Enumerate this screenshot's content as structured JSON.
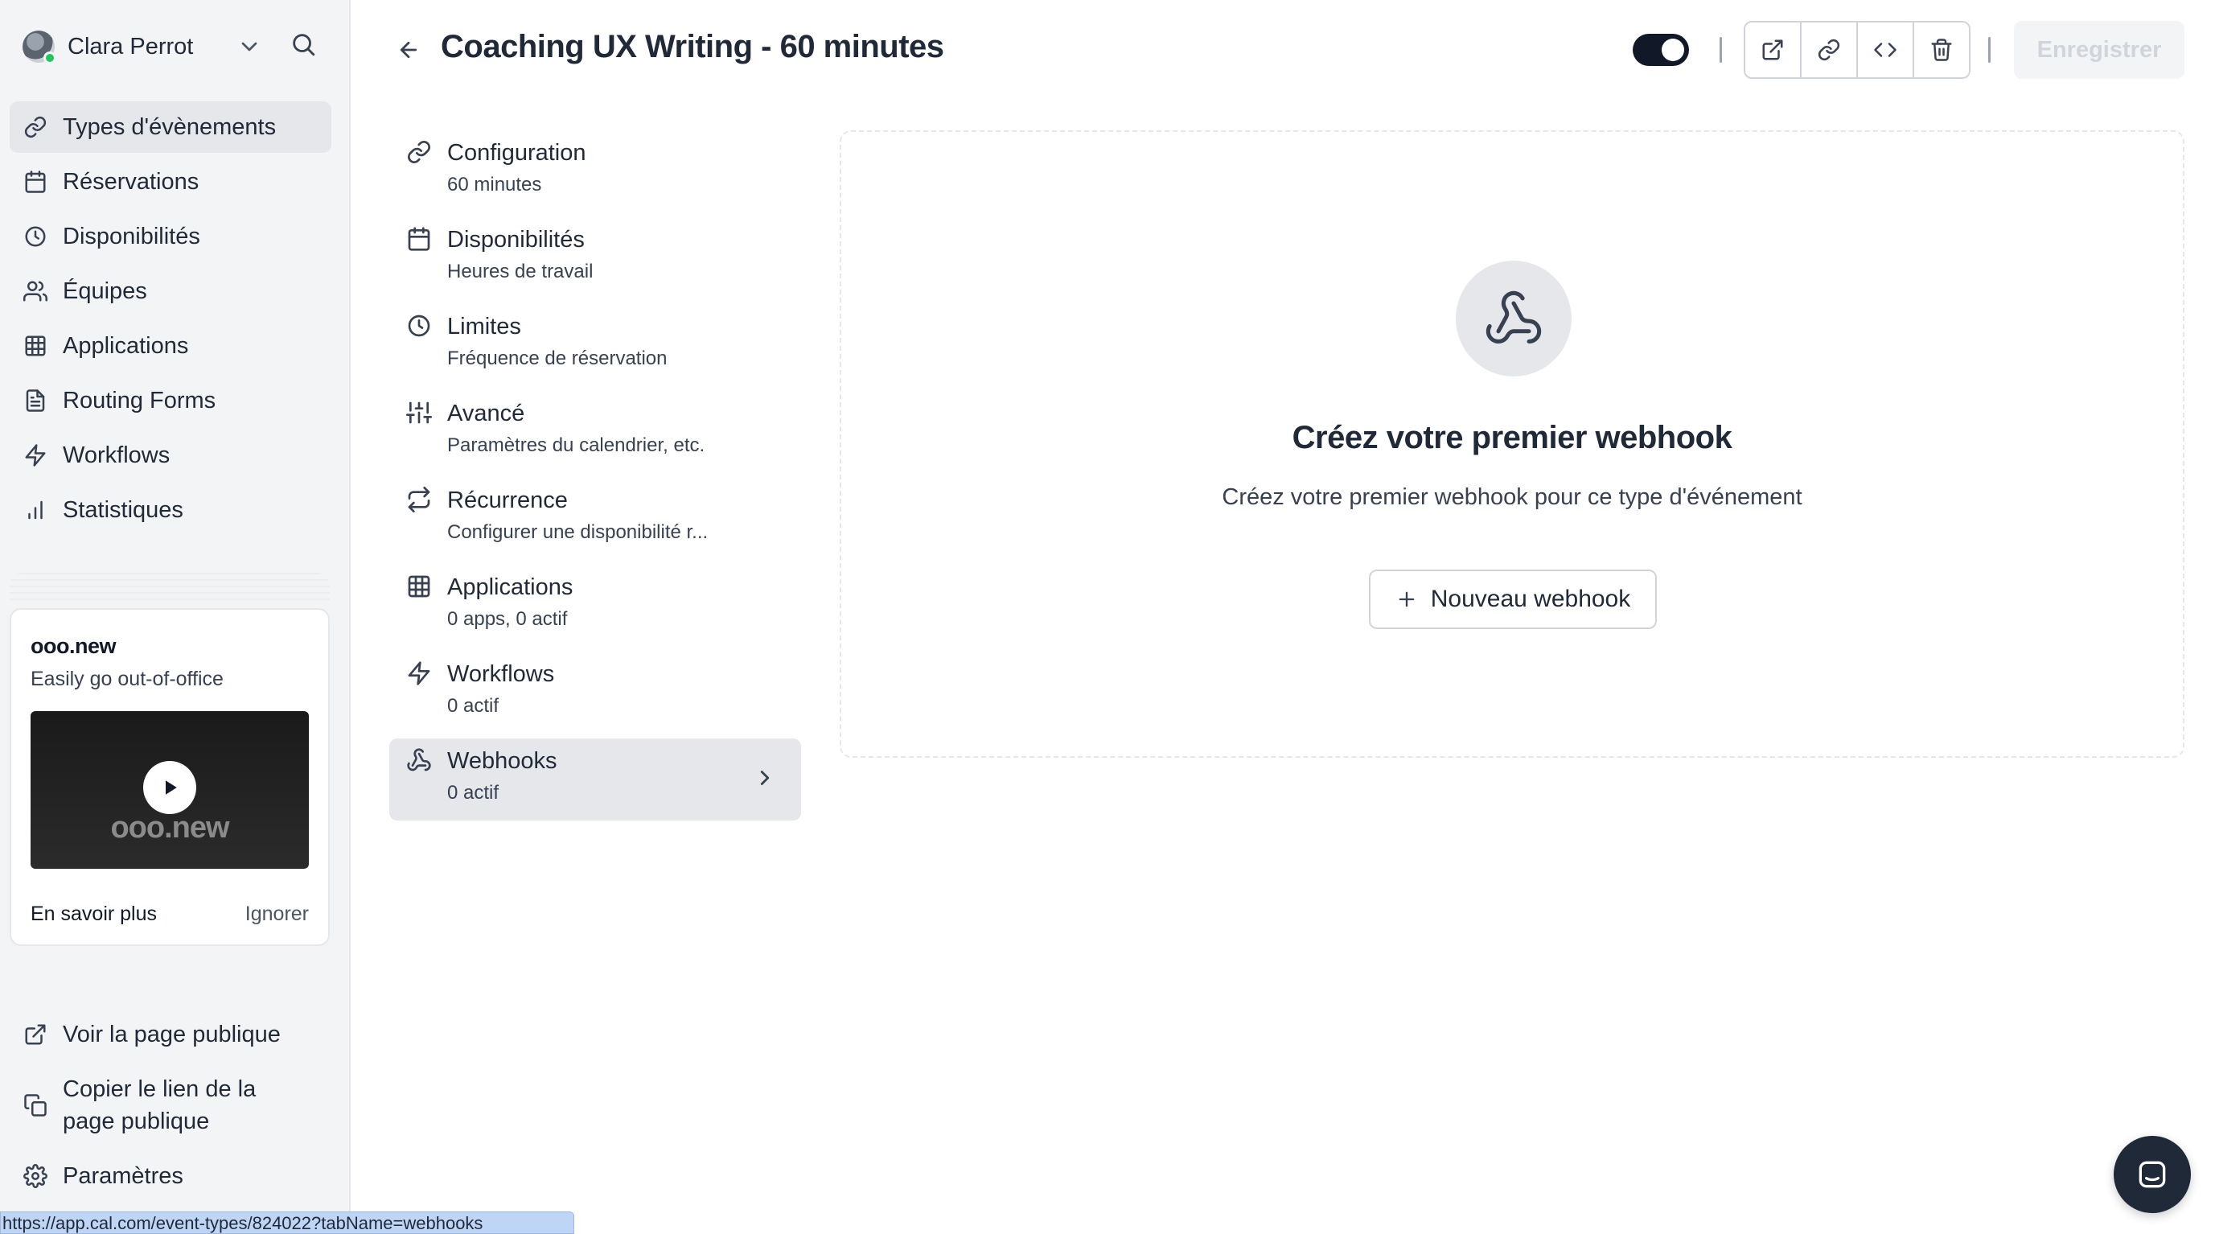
{
  "user": {
    "name": "Clara Perrot"
  },
  "nav": {
    "items": [
      {
        "label": "Types d'évènements",
        "icon": "link-icon",
        "active": true
      },
      {
        "label": "Réservations",
        "icon": "calendar-icon",
        "active": false
      },
      {
        "label": "Disponibilités",
        "icon": "clock-icon",
        "active": false
      },
      {
        "label": "Équipes",
        "icon": "users-icon",
        "active": false
      },
      {
        "label": "Applications",
        "icon": "grid-icon",
        "active": false
      },
      {
        "label": "Routing Forms",
        "icon": "file-icon",
        "active": false
      },
      {
        "label": "Workflows",
        "icon": "zap-icon",
        "active": false
      },
      {
        "label": "Statistiques",
        "icon": "bar-chart-icon",
        "active": false
      }
    ]
  },
  "promo": {
    "brand": "ooo.new",
    "subtitle": "Easily go out-of-office",
    "video_brand": "ooo.new",
    "learn_more": "En savoir plus",
    "dismiss": "Ignorer"
  },
  "bottom_links": [
    {
      "label": "Voir la page publique",
      "icon": "external-link-icon"
    },
    {
      "label": "Copier le lien de la page publique",
      "icon": "copy-icon"
    },
    {
      "label": "Paramètres",
      "icon": "gear-icon"
    }
  ],
  "status_url": "https://app.cal.com/event-types/824022?tabName=webhooks",
  "header": {
    "title": "Coaching UX Writing - 60 minutes",
    "toggle_on": true,
    "save_label": "Enregistrer"
  },
  "sections": [
    {
      "title": "Configuration",
      "subtitle": "60 minutes",
      "icon": "link-icon",
      "active": false
    },
    {
      "title": "Disponibilités",
      "subtitle": "Heures de travail",
      "icon": "calendar-icon",
      "active": false
    },
    {
      "title": "Limites",
      "subtitle": "Fréquence de réservation",
      "icon": "clock-icon",
      "active": false
    },
    {
      "title": "Avancé",
      "subtitle": "Paramètres du calendrier, etc.",
      "icon": "sliders-icon",
      "active": false
    },
    {
      "title": "Récurrence",
      "subtitle": "Configurer une disponibilité r...",
      "icon": "repeat-icon",
      "active": false
    },
    {
      "title": "Applications",
      "subtitle": "0 apps, 0 actif",
      "icon": "grid-icon",
      "active": false
    },
    {
      "title": "Workflows",
      "subtitle": "0 actif",
      "icon": "zap-icon",
      "active": false
    },
    {
      "title": "Webhooks",
      "subtitle": "0 actif",
      "icon": "webhook-icon",
      "active": true
    }
  ],
  "empty_state": {
    "title": "Créez votre premier webhook",
    "description": "Créez votre premier webhook pour ce type d'événement",
    "button_label": "Nouveau webhook"
  },
  "colors": {
    "sidebar_bg": "#f3f4f6",
    "active_bg": "#e5e7eb",
    "toggle_on": "#111827",
    "status_online": "#22c55e"
  }
}
